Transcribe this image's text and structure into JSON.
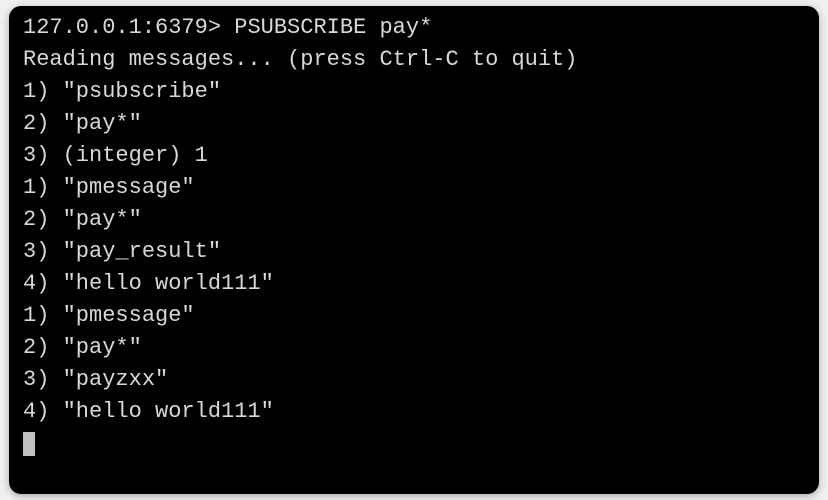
{
  "prompt": {
    "address": "127.0.0.1:6379",
    "separator": "> ",
    "command": "PSUBSCRIBE pay*"
  },
  "status_line": "Reading messages... (press Ctrl-C to quit)",
  "output_lines": [
    "1) \"psubscribe\"",
    "2) \"pay*\"",
    "3) (integer) 1",
    "1) \"pmessage\"",
    "2) \"pay*\"",
    "3) \"pay_result\"",
    "4) \"hello world111\"",
    "1) \"pmessage\"",
    "2) \"pay*\"",
    "3) \"payzxx\"",
    "4) \"hello world111\""
  ]
}
